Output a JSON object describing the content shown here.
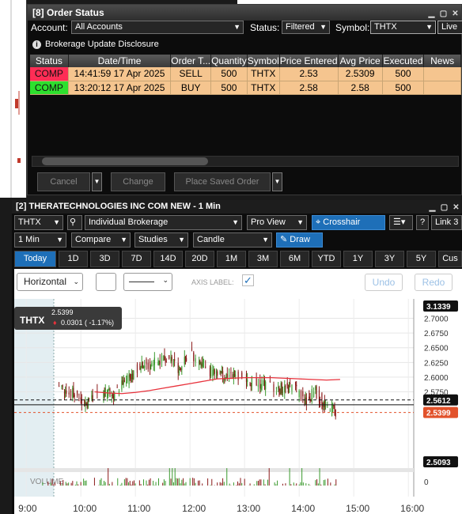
{
  "order_window": {
    "title": "[8] Order Status",
    "account_label": "Account:",
    "account_value": "All Accounts",
    "status_label": "Status:",
    "status_value": "Filtered",
    "symbol_label": "Symbol:",
    "symbol_value": "THTX",
    "view_label": "Live",
    "disclosure": "Brokerage Update Disclosure",
    "columns": [
      "Status",
      "Date/Time",
      "Order T...",
      "Quantity",
      "Symbol",
      "Price Entered",
      "Avg Price",
      "Executed",
      "News"
    ],
    "rows": [
      {
        "status": "COMP",
        "status_color": "#ff2d55",
        "datetime": "14:41:59 17 Apr 2025",
        "type": "SELL",
        "qty": "500",
        "symbol": "THTX",
        "price": "2.53",
        "avg": "2.5309",
        "executed": "500",
        "news": ""
      },
      {
        "status": "COMP",
        "status_color": "#2ee02e",
        "datetime": "13:20:12 17 Apr 2025",
        "type": "BUY",
        "qty": "500",
        "symbol": "THTX",
        "price": "2.58",
        "avg": "2.58",
        "executed": "500",
        "news": ""
      }
    ],
    "buttons": {
      "cancel": "Cancel",
      "change": "Change",
      "place_saved": "Place Saved Order"
    }
  },
  "chart_window": {
    "title": "[2] THERATECHNOLOGIES INC COM NEW - 1 Min",
    "symbol": "THTX",
    "account": "Individual Brokerage",
    "view": "Pro View",
    "crosshair": "Crosshair",
    "link": "Link 3",
    "interval": "1 Min",
    "compare": "Compare",
    "studies": "Studies",
    "chart_type": "Candle",
    "draw": "Draw",
    "ranges": [
      "Today",
      "1D",
      "3D",
      "7D",
      "14D",
      "20D",
      "1M",
      "3M",
      "6M",
      "YTD",
      "1Y",
      "3Y",
      "5Y",
      "Cus"
    ],
    "drawing_toolbar": {
      "orientation": "Horizontal",
      "axis_label": "AXIS LABEL:",
      "undo": "Undo",
      "redo": "Redo"
    },
    "legend": {
      "symbol": "THTX",
      "price": "2.5399",
      "change": "0.0301 ( -1.17%)"
    },
    "volume_label": "VOLUME",
    "colors": {
      "accent": "#1e6fb8",
      "up": "#3b9a2e",
      "down": "#8b1a1a",
      "ma": "#e8323c"
    }
  },
  "chart_data": {
    "type": "candlestick",
    "x_ticks": [
      "9:00",
      "10:00",
      "11:00",
      "12:00",
      "13:00",
      "14:00",
      "15:00",
      "16:00"
    ],
    "y_ticks": [
      "2.7000",
      "2.6750",
      "2.6500",
      "2.6250",
      "2.6000",
      "2.5750"
    ],
    "y_range": [
      2.495,
      2.733
    ],
    "price_tags": [
      {
        "value": "3.1339",
        "kind": "top",
        "color": "#111"
      },
      {
        "value": "2.5612",
        "kind": "line",
        "color": "#111"
      },
      {
        "value": "2.5399",
        "kind": "last",
        "color": "#e2522b"
      },
      {
        "value": "2.5093",
        "kind": "low",
        "color": "#111"
      }
    ],
    "volume_ticks": [
      "0"
    ],
    "moving_average": [
      [
        10.25,
        2.575
      ],
      [
        10.5,
        2.573
      ],
      [
        10.75,
        2.572
      ],
      [
        11.0,
        2.574
      ],
      [
        11.25,
        2.577
      ],
      [
        11.5,
        2.581
      ],
      [
        11.75,
        2.585
      ],
      [
        12.0,
        2.589
      ],
      [
        12.25,
        2.593
      ],
      [
        12.5,
        2.597
      ],
      [
        12.75,
        2.598
      ],
      [
        13.0,
        2.599
      ],
      [
        13.25,
        2.599
      ],
      [
        13.5,
        2.599
      ],
      [
        13.75,
        2.598
      ],
      [
        14.0,
        2.597
      ],
      [
        14.25,
        2.596
      ],
      [
        14.5,
        2.595
      ],
      [
        14.75,
        2.596
      ]
    ]
  }
}
